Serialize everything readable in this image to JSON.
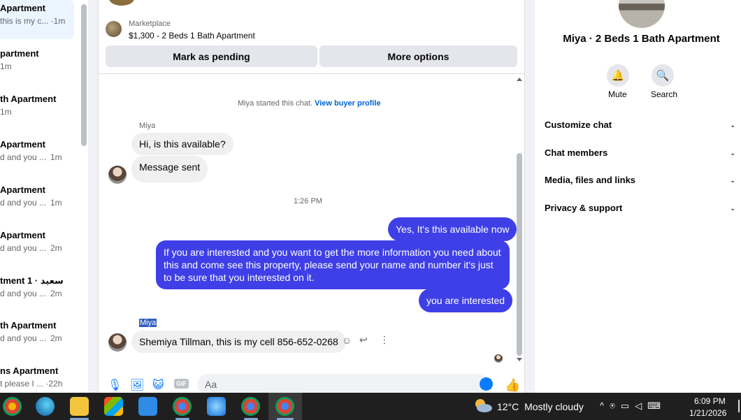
{
  "conversations": [
    {
      "title": "Apartment",
      "snippet": "this is my c... ·1m"
    },
    {
      "title": "partment",
      "snippet": "1m"
    },
    {
      "title": "th Apartment",
      "snippet": "1m"
    },
    {
      "title": "Apartment",
      "snippet": "d and you ...",
      "time": "1m"
    },
    {
      "title": "Apartment",
      "snippet": "d and you ...",
      "time": "1m"
    },
    {
      "title": "Apartment",
      "snippet": "d and you ...",
      "time": "2m"
    },
    {
      "title": "tment 1 · سعيد",
      "snippet": "d and you ...",
      "time": "2m"
    },
    {
      "title": "th Apartment",
      "snippet": "d and you ...",
      "time": "2m"
    },
    {
      "title": "ns Apartment",
      "snippet": "t please I ... ·22h"
    }
  ],
  "listing": {
    "label": "Marketplace",
    "title": "$1,300 - 2 Beds 1 Bath Apartment",
    "mark_pending": "Mark as pending",
    "more_options": "More options"
  },
  "thread": {
    "started_text": "Miya started this chat.",
    "view_profile": "View buyer profile",
    "sender_name": "Miya",
    "msg1": "Hi, is this available?",
    "msg2": "Message sent",
    "time_divider": "1:26 PM",
    "out1": "Yes, It's this available now",
    "out2": "If you are interested and you want to get the more information you need about this and come see this property, please send your name and number it's just to be sure that you interested on it.",
    "out3": "you are interested",
    "sender_name_selected": "Miya",
    "msg3": "Shemiya Tillman, this is my cell 856-652-0268"
  },
  "composer": {
    "placeholder": "Aa",
    "gif_label": "GIF"
  },
  "right_panel": {
    "name": "Miya · 2 Beds 1 Bath Apartment",
    "mute_label": "Mute",
    "search_label": "Search",
    "sections": [
      "Customize chat",
      "Chat members",
      "Media, files and links",
      "Privacy & support"
    ]
  },
  "taskbar": {
    "temperature": "12°C",
    "condition": "Mostly cloudy",
    "time": "6:09 PM",
    "date": "1/21/2026"
  },
  "colors": {
    "accent": "#0a7cff",
    "outgoing_bubble": "#3f3fe8"
  }
}
